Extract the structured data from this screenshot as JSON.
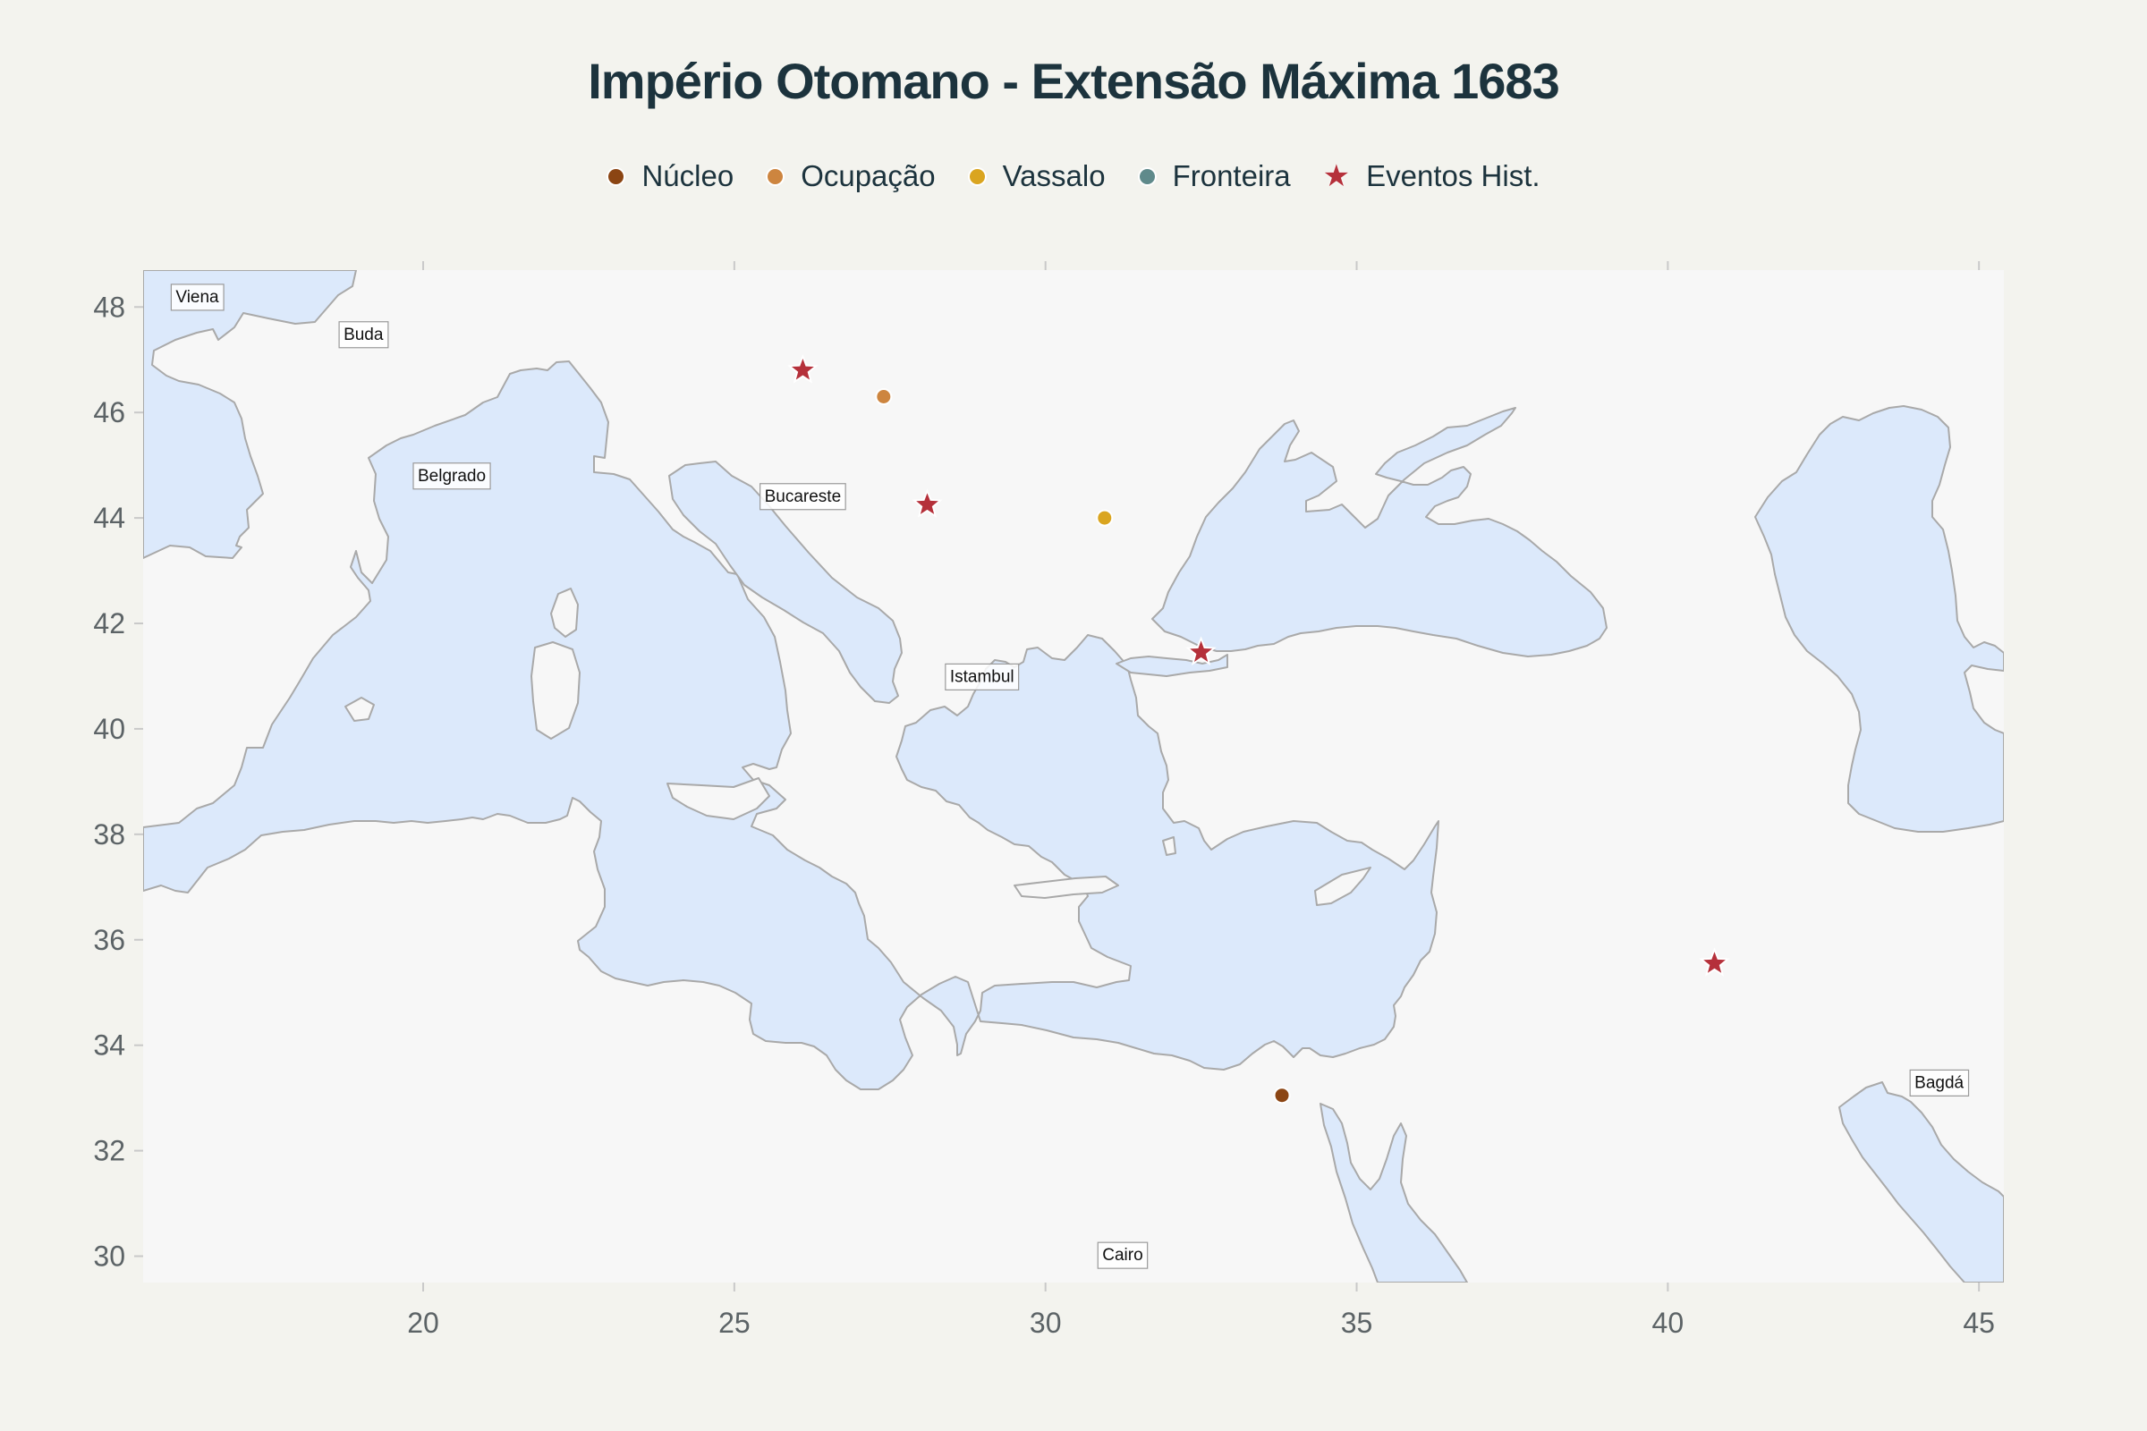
{
  "title": "Império Otomano - Extensão Máxima 1683",
  "legend": [
    {
      "label": "Núcleo",
      "color": "#8b4513",
      "symbol": "circle",
      "name": "legend-item-nucleo"
    },
    {
      "label": "Ocupação",
      "color": "#cd853f",
      "symbol": "circle",
      "name": "legend-item-ocupacao"
    },
    {
      "label": "Vassalo",
      "color": "#daa520",
      "symbol": "circle",
      "name": "legend-item-vassalo"
    },
    {
      "label": "Fronteira",
      "color": "#5f8a8b",
      "symbol": "circle",
      "name": "legend-item-fronteira"
    },
    {
      "label": "Eventos Hist.",
      "color": "#b5303a",
      "symbol": "star",
      "name": "legend-item-eventos"
    }
  ],
  "colors": {
    "background": "#f3f3ee",
    "plot_background": "#f7f7f7",
    "water": "#dce9fb",
    "coastline": "#a9a9a9",
    "title": "#1c333d"
  },
  "map": {
    "lon_range": [
      15.5,
      45.4
    ],
    "lat_range": [
      29.5,
      48.7
    ],
    "x_ticks": [
      20,
      25,
      30,
      35,
      40,
      45
    ],
    "y_ticks": [
      30,
      32,
      34,
      36,
      38,
      40,
      42,
      44,
      46,
      48
    ],
    "cities": [
      {
        "name": "Viena",
        "lon": 16.37,
        "lat": 48.21
      },
      {
        "name": "Buda",
        "lon": 19.04,
        "lat": 47.5
      },
      {
        "name": "Belgrado",
        "lon": 20.46,
        "lat": 44.82
      },
      {
        "name": "Bucareste",
        "lon": 26.1,
        "lat": 44.43
      },
      {
        "name": "Istambul",
        "lon": 28.98,
        "lat": 41.01
      },
      {
        "name": "Cairo",
        "lon": 31.24,
        "lat": 30.04
      },
      {
        "name": "Bagdá",
        "lon": 44.36,
        "lat": 33.31
      }
    ],
    "points": [
      {
        "category": "Núcleo",
        "lon": 33.8,
        "lat": 33.05,
        "color": "#8b4513"
      },
      {
        "category": "Ocupação",
        "lon": 27.4,
        "lat": 46.3,
        "color": "#cd853f"
      },
      {
        "category": "Vassalo",
        "lon": 30.95,
        "lat": 44.0,
        "color": "#daa520"
      }
    ],
    "events": [
      {
        "lon": 26.1,
        "lat": 46.8
      },
      {
        "lon": 28.1,
        "lat": 44.25
      },
      {
        "lon": 32.5,
        "lat": 41.45
      },
      {
        "lon": 40.75,
        "lat": 35.55
      }
    ]
  }
}
